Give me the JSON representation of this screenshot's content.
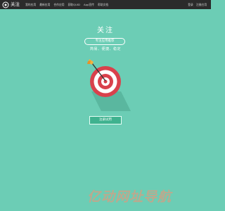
{
  "brand": {
    "name": "关注"
  },
  "nav": {
    "items": [
      "我的应用",
      "最新应用",
      "合作应用",
      "获取QUID",
      "App宣传",
      "帮助文档"
    ]
  },
  "right_nav": {
    "items": [
      "登录",
      "注册应用"
    ]
  },
  "hero": {
    "title": "关注",
    "pill": "专注应用推荐",
    "subtitle": "简易、便捷、稳定",
    "cta": "注册试用"
  },
  "watermark": {
    "text": "亿动网址导航"
  },
  "colors": {
    "background": "#6ccdb5",
    "topbar": "#2b2b2b",
    "target_red": "#d9414c",
    "button": "#3fb28f"
  }
}
